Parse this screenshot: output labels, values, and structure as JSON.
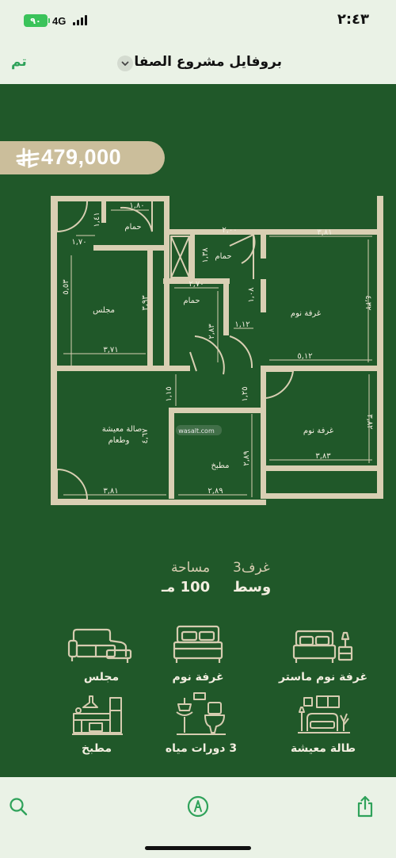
{
  "status_bar": {
    "battery": "٩٠",
    "network": "4G",
    "time": "٢:٤٣"
  },
  "nav": {
    "done_label": "تم",
    "title": "بروفايل مشروع الصفا"
  },
  "listing": {
    "price": "479,000",
    "currency_icon": "riyal-icon",
    "floor_plan": {
      "rooms": {
        "majlis": "مجلس",
        "bath_1": "حمام",
        "bath_2": "حمام",
        "bath_3": "حمام",
        "bedroom_1": "غرفة نوم",
        "bedroom_2": "غرفة نوم",
        "living": "صالة معيشة",
        "dining": "وطعام",
        "kitchen": "مطبخ"
      },
      "dimensions": {
        "d1": "١,٨٠",
        "d2": "١,٤١",
        "d3": "١,٧٠",
        "d4": "٥,٥٣",
        "d5": "٣,٩٣",
        "d6": "٣,٧١",
        "d7": "٢,٠٠",
        "d8": "١,٣٨",
        "d9": "٣,٨١",
        "d10": "٢,٧٠",
        "d11": "١,٠٨",
        "d12": "٤,٣٢",
        "d13": "٢,٨٣",
        "d14": "١,١٢",
        "d15": "٥,١٢",
        "d16": "١,١٥",
        "d17": "١,٢٥",
        "d18": "٤,٦٧",
        "d19": "٣,٨٢",
        "d20": "٢,٨٩",
        "d21": "٣,٨١",
        "d22": "٢,٨٩",
        "d23": "٣,٨٣"
      },
      "watermark": "wasalt.com"
    },
    "summary": {
      "rooms": "غرف3",
      "area_label": "مساحة",
      "position": "وسط",
      "area_value": "100 مـ"
    },
    "features": [
      {
        "label": "غرفة نوم ماستر",
        "icon": "master-bedroom-icon"
      },
      {
        "label": "غرفة نوم",
        "icon": "bed-icon"
      },
      {
        "label": "مجلس",
        "icon": "sofa-icon"
      },
      {
        "label": "طالة معيشة",
        "icon": "living-room-icon"
      },
      {
        "label": "3 دورات مياه",
        "icon": "bathroom-icon"
      },
      {
        "label": "مطبخ",
        "icon": "kitchen-icon"
      }
    ]
  },
  "toolbar": {
    "left_icon": "search-icon",
    "center_icon": "markup-icon",
    "right_icon": "share-icon"
  },
  "colors": {
    "panel_green": "#205829",
    "wall_beige": "#d9cfb3",
    "accent_green": "#2fa25a",
    "app_background": "#eaf2e6"
  }
}
